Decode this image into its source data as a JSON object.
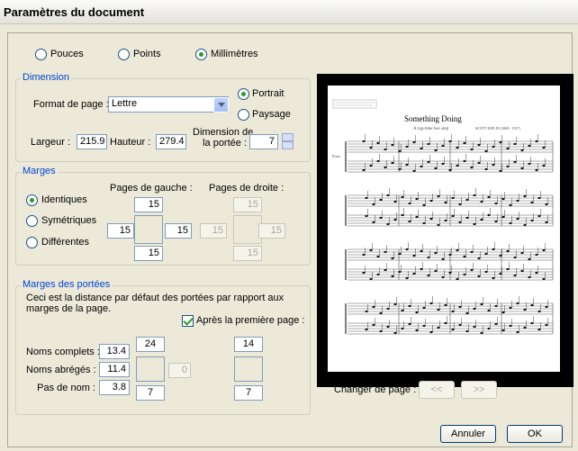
{
  "window": {
    "title": "Paramètres du document"
  },
  "units": {
    "options": [
      {
        "label": "Pouces",
        "selected": false
      },
      {
        "label": "Points",
        "selected": false
      },
      {
        "label": "Millimètres",
        "selected": true
      }
    ]
  },
  "dimension": {
    "legend": "Dimension",
    "format_label": "Format de page :",
    "format_value": "Lettre",
    "orientation": [
      {
        "label": "Portrait",
        "selected": true
      },
      {
        "label": "Paysage",
        "selected": false
      }
    ],
    "width_label": "Largeur :",
    "width_value": "215.9",
    "height_label": "Hauteur :",
    "height_value": "279.4",
    "staff_label_1": "Dimension de",
    "staff_label_2": "la portée :",
    "staff_value": "7"
  },
  "margins": {
    "legend": "Marges",
    "options": [
      {
        "label": "Identiques",
        "selected": true
      },
      {
        "label": "Symétriques",
        "selected": false
      },
      {
        "label": "Différentes",
        "selected": false
      }
    ],
    "left_pages_label": "Pages de gauche :",
    "right_pages_label": "Pages de droite :",
    "left": {
      "top": "15",
      "left": "15",
      "right": "15",
      "bottom": "15"
    },
    "right": {
      "top": "15",
      "left": "15",
      "right": "15",
      "bottom": "15"
    }
  },
  "staff_margins": {
    "legend": "Marges des portées",
    "description": "Ceci est la distance par défaut des portées par rapport aux marges de la page.",
    "after_first_label": "Après la première page :",
    "after_first_checked": true,
    "full_names_label": "Noms complets :",
    "full_names_value": "13.4",
    "short_names_label": "Noms abrégés :",
    "short_names_value": "11.4",
    "no_name_label": "Pas de nom :",
    "no_name_value": "3.8",
    "first_top": "24",
    "first_left": "0",
    "first_bottom": "7",
    "after_top": "14",
    "after_bottom": "7"
  },
  "preview": {
    "score_title": "Something Doing",
    "score_subtitle": "A rag-time two step",
    "composer": "SCOTT JOPLIN (1868 - 1917)",
    "instrument": "Piano"
  },
  "page_nav": {
    "label": "Changer de page :",
    "prev": "<<",
    "next": ">>"
  },
  "buttons": {
    "cancel": "Annuler",
    "ok": "OK"
  }
}
